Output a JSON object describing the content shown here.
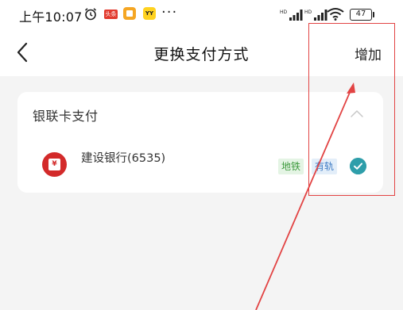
{
  "status_bar": {
    "time": "上午10:07",
    "news_app_label": "头条",
    "yellow_app_label": "YY",
    "more_dots": "···",
    "battery_level": "47",
    "icons": [
      "alarm-clock-icon",
      "news-app-icon",
      "orange-app-icon",
      "yellow-app-icon",
      "hd-signal-icon",
      "hd-signal-icon",
      "wifi-icon",
      "battery-icon"
    ]
  },
  "navbar": {
    "back_icon": "chevron-left-icon",
    "title": "更换支付方式",
    "add_label": "增加"
  },
  "section": {
    "title": "银联卡支付",
    "collapse_icon": "chevron-up-icon",
    "card": {
      "logo_icon": "ccb-bank-logo-icon",
      "logo_glyph": "¥",
      "name": "建设银行(6535)",
      "tags": [
        "地铁",
        "有轨"
      ],
      "selected_icon": "check-circle-icon",
      "selected": true
    }
  },
  "annotation": {
    "highlight_color": "#e24343",
    "arrow_color": "#e24343"
  },
  "colors": {
    "metro_tag_text": "#3e9a3e",
    "rail_tag_text": "#3f7cc4",
    "check_fill": "#2e9eaa",
    "bank_red": "#d32a2a"
  }
}
